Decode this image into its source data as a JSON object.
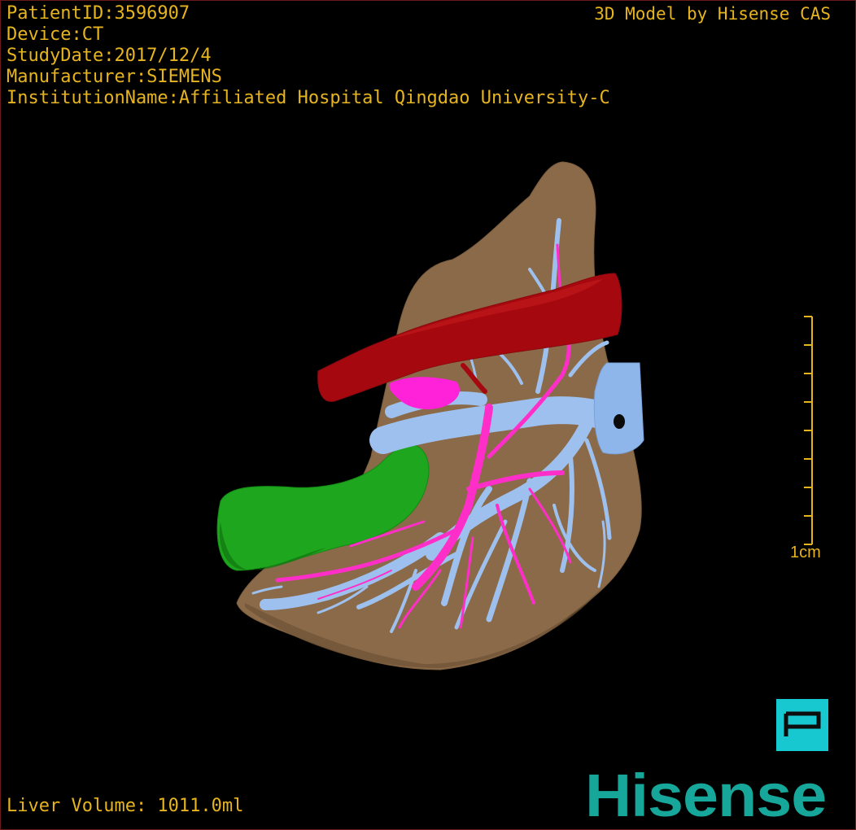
{
  "header": {
    "patient_id": "PatientID:3596907",
    "device": "Device:CT",
    "study_date": "StudyDate:2017/12/4",
    "manufacturer": "Manufacturer:SIEMENS",
    "institution": "InstitutionName:Affiliated Hospital Qingdao University-C"
  },
  "credit": "3D Model by Hisense CAS",
  "scale_bar": {
    "label": "1cm"
  },
  "footer": {
    "liver_volume": "Liver Volume: 1011.0ml"
  },
  "logo": {
    "text": "Hisense"
  },
  "colors": {
    "overlay_text": "#e6b41e",
    "liver": "#8a6a48",
    "inferior_vena_cava": "#a5080e",
    "portal_vein": "#9ec0ee",
    "hepatic_artery": "#ff2ec8",
    "gallbladder": "#1ea61e",
    "brand_teal": "#17c8d1"
  },
  "icons": {
    "p_button": "p-letter-icon"
  }
}
